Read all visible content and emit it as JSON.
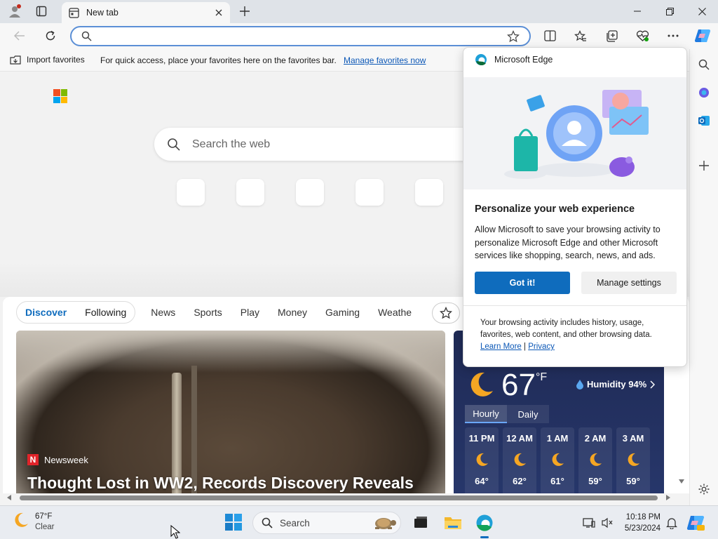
{
  "browser": {
    "tab_title": "New tab",
    "address_value": "",
    "favorites_bar": {
      "import_label": "Import favorites",
      "hint": "For quick access, place your favorites here on the favorites bar.",
      "manage_link": "Manage favorites now"
    }
  },
  "newtab": {
    "search_placeholder": "Search the web",
    "feed_tabs": [
      "Discover",
      "Following"
    ],
    "feed_nav": [
      "News",
      "Sports",
      "Play",
      "Money",
      "Gaming",
      "Weathe"
    ],
    "hero": {
      "source": "Newsweek",
      "headline": "Thought Lost in WW2, Records Discovery Reveals"
    },
    "weather": {
      "temp": "67",
      "unit": "°F",
      "humidity": "Humidity 94%",
      "tabs": [
        "Hourly",
        "Daily"
      ],
      "hours": [
        {
          "time": "11 PM",
          "temp": "64°"
        },
        {
          "time": "12 AM",
          "temp": "62°"
        },
        {
          "time": "1 AM",
          "temp": "61°"
        },
        {
          "time": "2 AM",
          "temp": "59°"
        },
        {
          "time": "3 AM",
          "temp": "59°"
        }
      ]
    }
  },
  "popup": {
    "app_name": "Microsoft Edge",
    "title": "Personalize your web experience",
    "body": "Allow Microsoft to save your browsing activity to personalize Microsoft Edge and other Microsoft services like shopping, search, news, and ads.",
    "primary_button": "Got it!",
    "secondary_button": "Manage settings",
    "footer": "Your browsing activity includes history, usage, favorites, web content, and other browsing data.",
    "learn_more": "Learn More",
    "separator": "|",
    "privacy": "Privacy"
  },
  "taskbar": {
    "weather_temp": "67°F",
    "weather_cond": "Clear",
    "search_label": "Search",
    "time": "10:18 PM",
    "date": "5/23/2024"
  },
  "colors": {
    "accent": "#0f6cbd",
    "weather_bg": "#1f2a55"
  }
}
